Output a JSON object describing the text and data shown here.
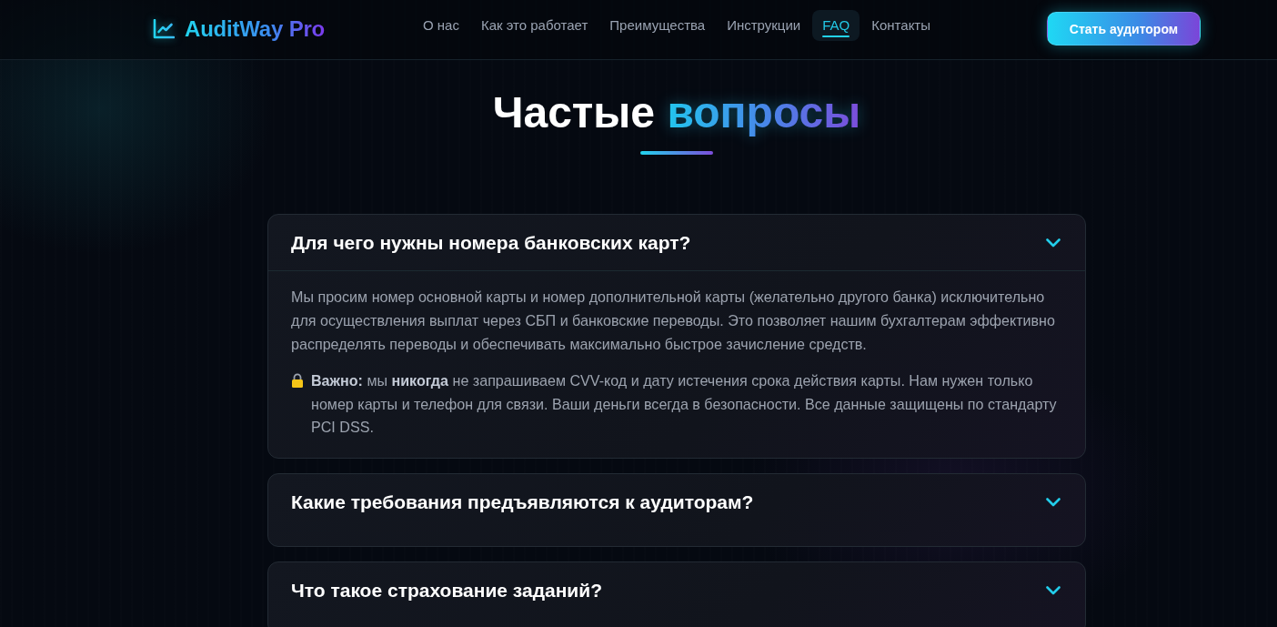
{
  "header": {
    "logo": "AuditWay Pro",
    "nav": [
      {
        "label": "О нас",
        "selected": false
      },
      {
        "label": "Как это работает",
        "selected": false
      },
      {
        "label": "Преимущества",
        "selected": false
      },
      {
        "label": "Инструкции",
        "selected": false
      },
      {
        "label": "FAQ",
        "selected": true
      },
      {
        "label": "Контакты",
        "selected": false
      }
    ],
    "cta": "Стать аудитором"
  },
  "heading": {
    "text": "Частые",
    "accent": "вопросы"
  },
  "faq": [
    {
      "question": "Для чего нужны номера банковских карт?",
      "expanded": true,
      "answer": [
        {
          "kind": "plain",
          "text": "Мы просим номер основной карты и номер дополнительной карты (желательно другого банка) исключительно для осуществления выплат через СБП и банковские переводы. Это позволяет нашим бухгалтерам эффективно распределять переводы и обеспечивать максимально быстрое зачисление средств."
        },
        {
          "kind": "note",
          "text": "**Важно:** мы **никогда** не запрашиваем CVV-код и дату истечения срока действия карты. Нам нужен только номер карты и телефон для связи. Ваши деньги всегда в безопасности. Все данные защищены по стандарту PCI DSS."
        }
      ]
    },
    {
      "question": "Какие требования предъявляются к аудиторам?",
      "expanded": false
    },
    {
      "question": "Что такое страхование заданий?",
      "expanded": false
    }
  ]
}
